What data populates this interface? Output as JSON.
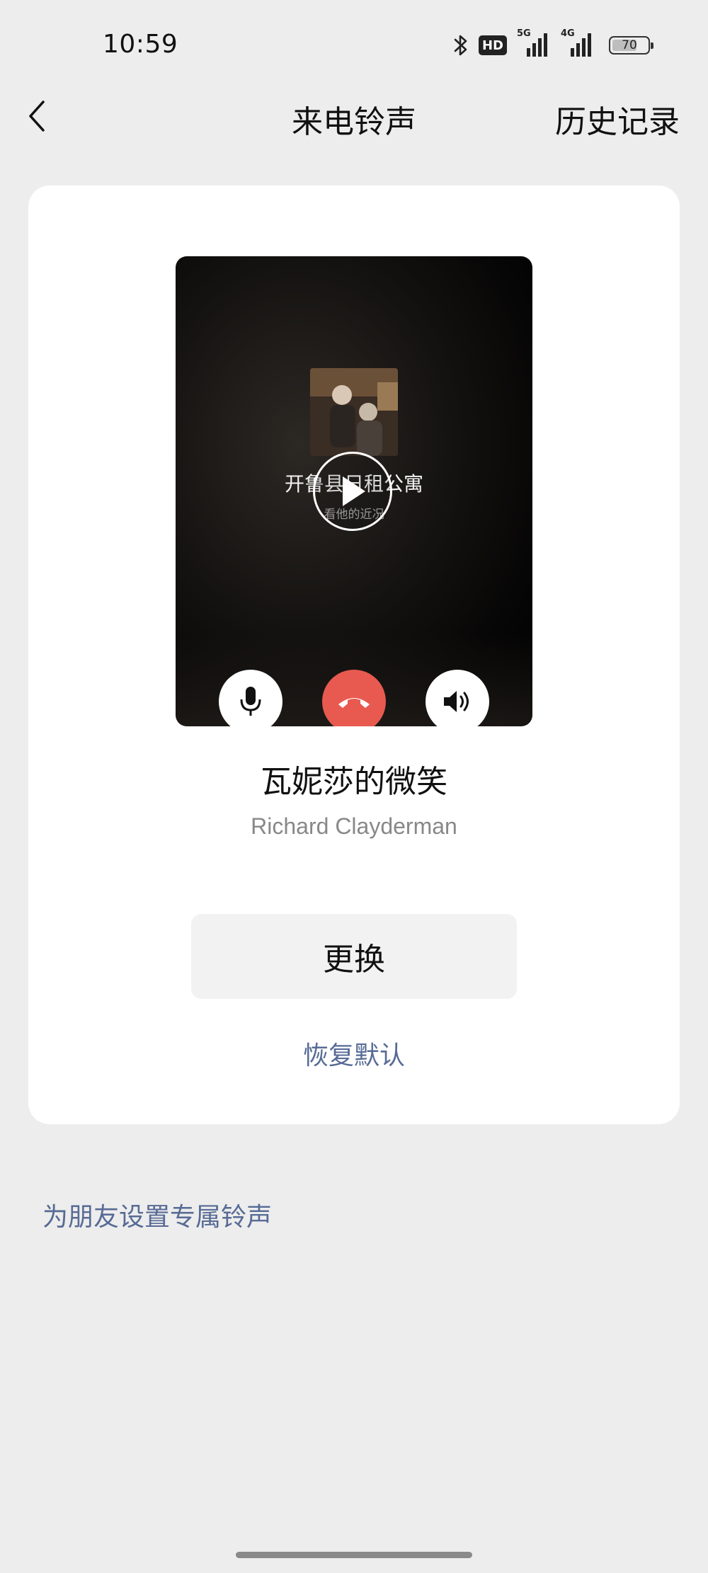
{
  "status_bar": {
    "time": "10:59",
    "hd_label": "HD",
    "network_1": "5G",
    "network_2": "4G",
    "battery": "70",
    "battery_level": 0.7
  },
  "nav": {
    "title": "来电铃声",
    "right_action": "历史记录"
  },
  "preview": {
    "caller_name": "开鲁县日租公寓",
    "caller_subtitle": "看他的近况"
  },
  "ringtone": {
    "title": "瓦妮莎的微笑",
    "artist": "Richard Clayderman"
  },
  "actions": {
    "change_label": "更换",
    "restore_label": "恢复默认",
    "friend_label": "为朋友设置专属铃声"
  },
  "colors": {
    "link": "#576b95",
    "hangup": "#e85a50",
    "background": "#ededed",
    "card": "#ffffff"
  },
  "icons": {
    "back": "chevron-left-icon",
    "play": "play-icon",
    "mic": "microphone-icon",
    "hangup": "phone-hangup-icon",
    "speaker": "speaker-icon"
  }
}
